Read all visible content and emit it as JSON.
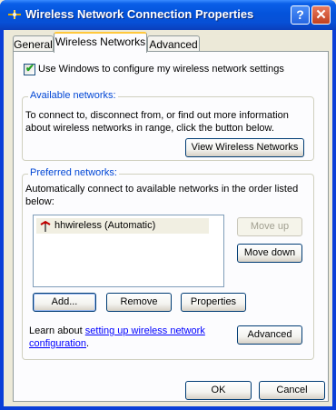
{
  "window": {
    "title": "Wireless Network Connection Properties",
    "help_glyph": "?",
    "close_glyph": "✕"
  },
  "tabs": [
    {
      "label": "General"
    },
    {
      "label": "Wireless Networks",
      "active": true
    },
    {
      "label": "Advanced"
    }
  ],
  "windows_config": {
    "checkbox_label": "Use Windows to configure my wireless network settings",
    "checked": true
  },
  "available": {
    "title": "Available networks:",
    "description_line1": "To connect to, disconnect from, or find out more information",
    "description_line2": "about wireless networks in range, click the button below.",
    "view_button": "View Wireless Networks"
  },
  "preferred": {
    "title": "Preferred networks:",
    "description_line1": "Automatically connect to available networks in the order listed",
    "description_line2": "below:",
    "networks": [
      {
        "label": "hhwireless (Automatic)",
        "icon": "wireless-network-icon"
      }
    ],
    "move_up": "Move up",
    "move_down": "Move down",
    "add": "Add...",
    "remove": "Remove",
    "properties": "Properties"
  },
  "learn": {
    "prefix": "Learn about ",
    "link_line1": "setting up wireless network",
    "link_line2": "configuration",
    "suffix": ".",
    "advanced_button": "Advanced"
  },
  "footer": {
    "ok": "OK",
    "cancel": "Cancel"
  },
  "colors": {
    "title_bar": "#0453DB",
    "group_title": "#0046D5",
    "link": "#0000FF",
    "face": "#ECE9D8"
  }
}
